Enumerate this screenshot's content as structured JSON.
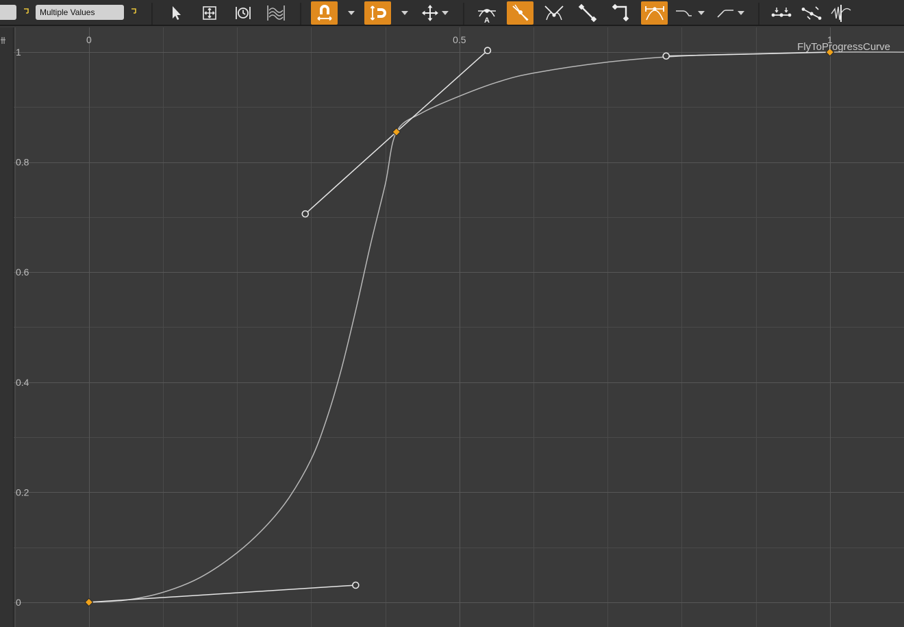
{
  "toolbar": {
    "value_field": "Multiple Values",
    "tools": [
      {
        "name": "select-tool-icon",
        "active": false
      },
      {
        "name": "frame-all-icon",
        "active": false
      },
      {
        "name": "frame-time-icon",
        "active": false
      },
      {
        "name": "view-curves-icon",
        "active": false
      },
      {
        "name": "snap-value-icon",
        "active": true
      },
      {
        "name": "snap-time-icon",
        "active": true
      },
      {
        "name": "transform-icon",
        "active": false
      },
      {
        "name": "auto-tangent-icon",
        "active": false
      },
      {
        "name": "user-tangent-icon",
        "active": true
      },
      {
        "name": "break-tangent-icon",
        "active": false
      },
      {
        "name": "linear-interp-icon",
        "active": false
      },
      {
        "name": "constant-interp-icon",
        "active": false
      },
      {
        "name": "weighted-tangent-icon",
        "active": true
      },
      {
        "name": "pre-infinity-icon",
        "active": false
      },
      {
        "name": "post-infinity-icon",
        "active": false
      },
      {
        "name": "flatten-tangents-icon",
        "active": false
      },
      {
        "name": "straighten-tangents-icon",
        "active": false
      },
      {
        "name": "bake-curve-icon",
        "active": false
      }
    ],
    "accent_color": "#e08a1e"
  },
  "graph": {
    "curve_name": "FlyToProgressCurve",
    "x_ticks": [
      "0",
      "0.5",
      "1"
    ],
    "y_ticks": [
      "1",
      "0.8",
      "0.6",
      "0.4",
      "0.2",
      "0"
    ]
  },
  "chart_data": {
    "type": "line",
    "title": "",
    "series": [
      {
        "name": "FlyToProgressCurve",
        "keys": [
          {
            "time": 0.0,
            "value": 0.0
          },
          {
            "time": 0.415,
            "value": 0.855
          },
          {
            "time": 1.0,
            "value": 1.0
          }
        ],
        "tangent_handles": [
          {
            "time": 0.36,
            "value": 0.031
          },
          {
            "time": 0.292,
            "value": 0.706
          },
          {
            "time": 0.538,
            "value": 1.003
          },
          {
            "time": 0.779,
            "value": 0.993
          }
        ],
        "curve_points": [
          [
            0.0,
            0.0
          ],
          [
            0.05,
            0.004
          ],
          [
            0.1,
            0.018
          ],
          [
            0.15,
            0.045
          ],
          [
            0.2,
            0.09
          ],
          [
            0.24,
            0.14
          ],
          [
            0.27,
            0.19
          ],
          [
            0.3,
            0.26
          ],
          [
            0.32,
            0.33
          ],
          [
            0.34,
            0.42
          ],
          [
            0.36,
            0.53
          ],
          [
            0.38,
            0.65
          ],
          [
            0.4,
            0.76
          ],
          [
            0.415,
            0.855
          ],
          [
            0.45,
            0.89
          ],
          [
            0.5,
            0.92
          ],
          [
            0.55,
            0.945
          ],
          [
            0.6,
            0.962
          ],
          [
            0.7,
            0.982
          ],
          [
            0.8,
            0.993
          ],
          [
            0.9,
            0.997
          ],
          [
            1.0,
            1.0
          ],
          [
            1.1,
            1.0
          ]
        ]
      }
    ],
    "xlim": [
      -0.12,
      1.1
    ],
    "ylim": [
      -0.045,
      1.045
    ],
    "grid": true,
    "key_color": "#f0a21a",
    "curve_color": "#b8b8b8",
    "handle_color": "#e6e6e6"
  }
}
